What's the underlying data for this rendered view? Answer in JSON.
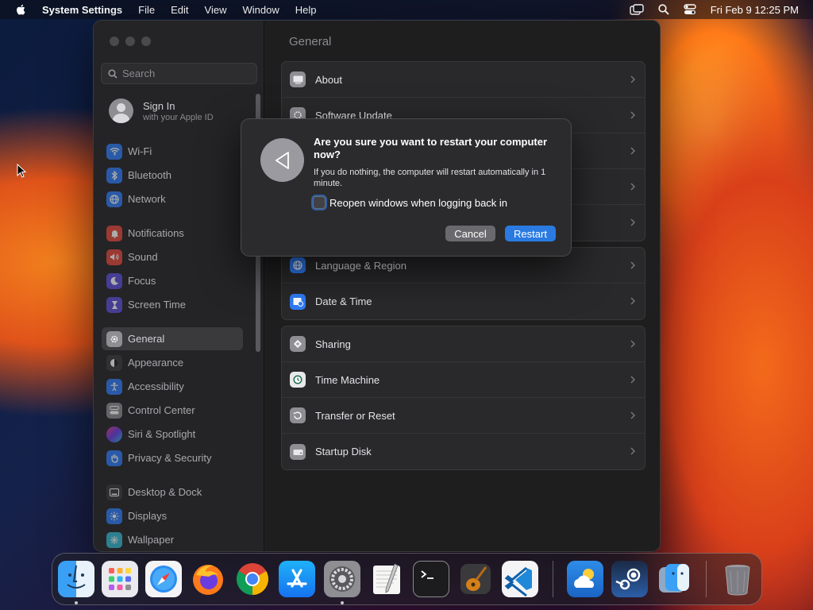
{
  "menubar": {
    "app_name": "System Settings",
    "menus": [
      "File",
      "Edit",
      "View",
      "Window",
      "Help"
    ],
    "clock": "Fri Feb 9  12:25 PM"
  },
  "sidebar": {
    "search_placeholder": "Search",
    "signin": {
      "title": "Sign In",
      "subtitle": "with your Apple ID"
    },
    "items": [
      {
        "label": "Wi-Fi",
        "icon": "wifi-icon",
        "color": "#2f7cf6"
      },
      {
        "label": "Bluetooth",
        "icon": "bluetooth-icon",
        "color": "#2f7cf6"
      },
      {
        "label": "Network",
        "icon": "globe-icon",
        "color": "#2f7cf6"
      },
      {
        "label": "Notifications",
        "icon": "bell-icon",
        "color": "#e5473c"
      },
      {
        "label": "Sound",
        "icon": "speaker-icon",
        "color": "#e5473c"
      },
      {
        "label": "Focus",
        "icon": "moon-icon",
        "color": "#5a4fd8"
      },
      {
        "label": "Screen Time",
        "icon": "hourglass-icon",
        "color": "#5a4fd8"
      },
      {
        "label": "General",
        "icon": "gear-icon",
        "color": "#8e8e93"
      },
      {
        "label": "Appearance",
        "icon": "appearance-icon",
        "color": "#2c2c2e"
      },
      {
        "label": "Accessibility",
        "icon": "accessibility-icon",
        "color": "#2f7cf6"
      },
      {
        "label": "Control Center",
        "icon": "control-center-icon",
        "color": "#8e8e93"
      },
      {
        "label": "Siri & Spotlight",
        "icon": "siri-icon",
        "color": "#b04bd6"
      },
      {
        "label": "Privacy & Security",
        "icon": "hand-icon",
        "color": "#2f7cf6"
      },
      {
        "label": "Desktop & Dock",
        "icon": "dock-icon",
        "color": "#2c2c2e"
      },
      {
        "label": "Displays",
        "icon": "sun-icon",
        "color": "#2f7cf6"
      },
      {
        "label": "Wallpaper",
        "icon": "wallpaper-icon",
        "color": "#35b9d0"
      }
    ]
  },
  "content": {
    "title": "General",
    "group1": [
      "About",
      "Software Update",
      "",
      "",
      ""
    ],
    "group2": [
      "Language & Region",
      "Date & Time"
    ],
    "group3": [
      "Sharing",
      "Time Machine",
      "Transfer or Reset",
      "Startup Disk"
    ]
  },
  "dialog": {
    "title": "Are you sure you want to restart your computer now?",
    "body": "If you do nothing, the computer will restart automatically in 1 minute.",
    "checkbox_label": "Reopen windows when logging back in",
    "cancel": "Cancel",
    "restart": "Restart"
  },
  "dock": {
    "apps": [
      "Finder",
      "Launchpad",
      "Safari",
      "Firefox",
      "Chrome",
      "App Store",
      "System Settings",
      "TextEdit",
      "Terminal",
      "GarageBand",
      "Visual Studio Code",
      "Weather",
      "Steam",
      "Finder Utility",
      "Trash"
    ]
  }
}
